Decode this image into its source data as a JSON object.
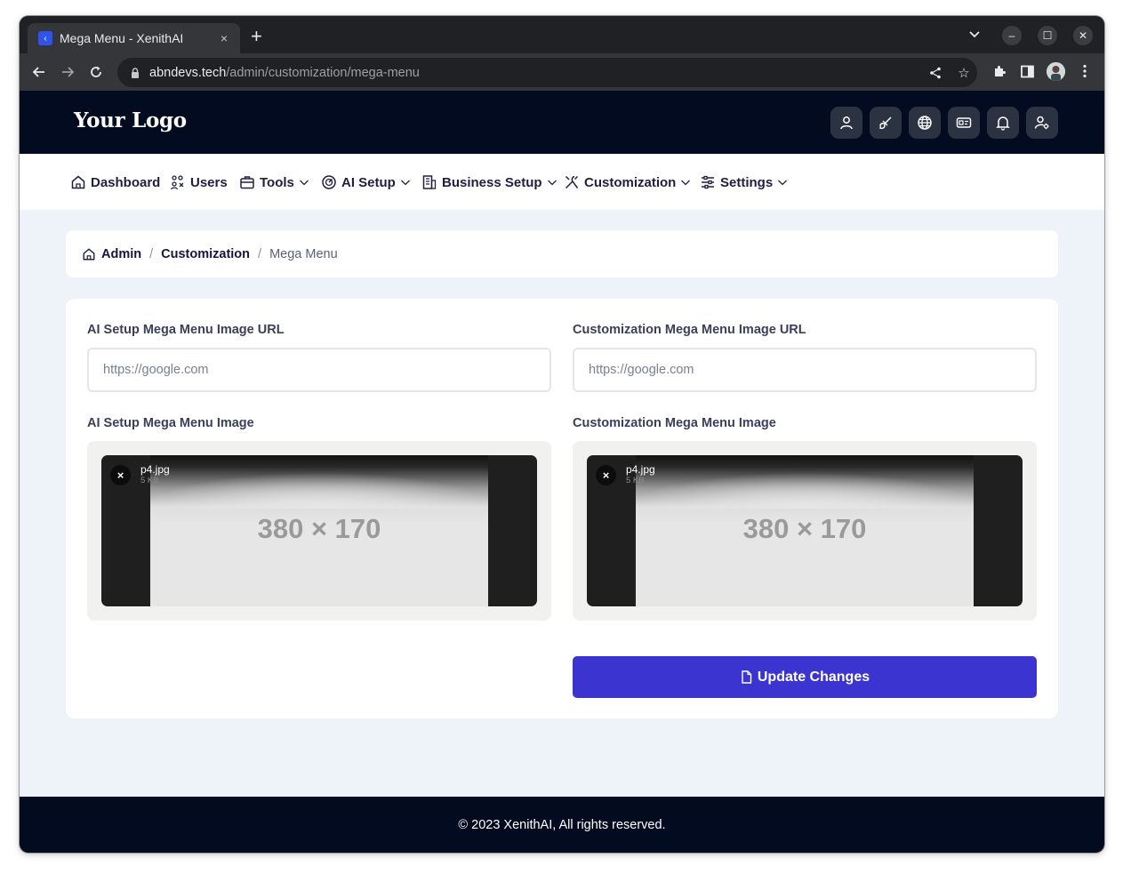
{
  "browser": {
    "tab_title": "Mega Menu - XenithAI",
    "tab_close": "×",
    "new_tab": "+",
    "url_host": "abndevs.tech",
    "url_path": "/admin/customization/mega-menu",
    "window_controls": [
      "–",
      "☐",
      "✕"
    ]
  },
  "header": {
    "logo": "Your Logo",
    "icons": [
      "user-icon",
      "brush-icon",
      "globe-icon",
      "id-card-icon",
      "bell-icon",
      "user-settings-icon"
    ]
  },
  "nav": {
    "items": [
      {
        "label": "Dashboard",
        "icon": "home-icon",
        "dropdown": false
      },
      {
        "label": "Users",
        "icon": "users-icon",
        "dropdown": false
      },
      {
        "label": "Tools",
        "icon": "briefcase-icon",
        "dropdown": true
      },
      {
        "label": "AI Setup",
        "icon": "gauge-icon",
        "dropdown": true
      },
      {
        "label": "Business Setup",
        "icon": "building-icon",
        "dropdown": true
      },
      {
        "label": "Customization",
        "icon": "tools-icon",
        "dropdown": true
      },
      {
        "label": "Settings",
        "icon": "sliders-icon",
        "dropdown": true
      }
    ]
  },
  "breadcrumb": {
    "items": [
      "Admin",
      "Customization"
    ],
    "separator": "/",
    "current": "Mega Menu"
  },
  "form": {
    "ai_url_label": "AI Setup Mega Menu Image URL",
    "ai_url_placeholder": "https://google.com",
    "cust_url_label": "Customization Mega Menu Image URL",
    "cust_url_placeholder": "https://google.com",
    "ai_image_label": "AI Setup Mega Menu Image",
    "cust_image_label": "Customization Mega Menu Image",
    "ai_file": {
      "name": "p4.jpg",
      "size": "5 KB",
      "preview_text": "380 × 170"
    },
    "cust_file": {
      "name": "p4.jpg",
      "size": "5 KB",
      "preview_text": "380 × 170"
    },
    "remove_label": "×",
    "submit_label": "Update Changes"
  },
  "footer": {
    "text": "© 2023 XenithAI, All rights reserved."
  },
  "colors": {
    "header_bg": "#020b1f",
    "primary": "#3b34d0",
    "page_bg": "#eef2f9"
  }
}
